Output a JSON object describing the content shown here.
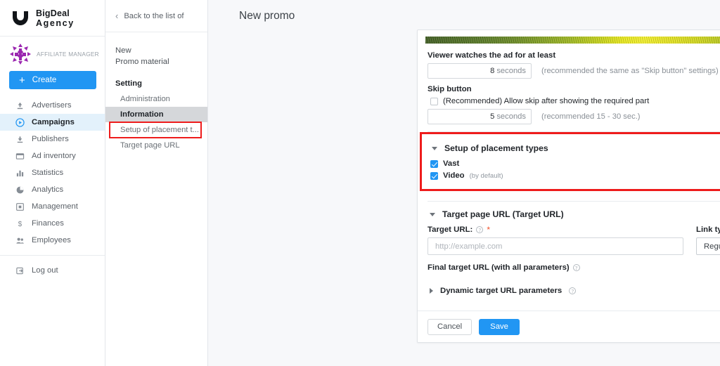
{
  "brand": {
    "line1": "BigDeal",
    "line2": "Agency",
    "logo_icon": "bigdeal-shield-logo"
  },
  "account": {
    "label": "AFFILIATE MANAGER",
    "logo_icon": "affiliate-mandala-logo",
    "create_label": "Create",
    "create_icon": "plus-icon",
    "accent_color": "#2196f3"
  },
  "sidebar": {
    "items": [
      {
        "label": "Advertisers",
        "icon": "upload-arrow-icon",
        "active": false
      },
      {
        "label": "Campaigns",
        "icon": "play-circle-icon",
        "active": true
      },
      {
        "label": "Publishers",
        "icon": "download-arrow-icon",
        "active": false
      },
      {
        "label": "Ad inventory",
        "icon": "browser-window-icon",
        "active": false
      },
      {
        "label": "Statistics",
        "icon": "bar-chart-icon",
        "active": false
      },
      {
        "label": "Analytics",
        "icon": "pie-chart-icon",
        "active": false
      },
      {
        "label": "Management",
        "icon": "grid-square-icon",
        "active": false
      },
      {
        "label": "Finances",
        "icon": "dollar-icon",
        "active": false
      },
      {
        "label": "Employees",
        "icon": "people-icon",
        "active": false
      }
    ],
    "logout": {
      "label": "Log out",
      "icon": "logout-icon"
    }
  },
  "subnav": {
    "back_label": "Back to the list of",
    "back_icon": "chevron-left-icon",
    "title_line1": "New",
    "title_line2": "Promo material",
    "items": [
      {
        "label": "Setting",
        "type": "group",
        "selected": false,
        "boxed": false
      },
      {
        "label": "Administration",
        "type": "indent",
        "selected": false,
        "boxed": false
      },
      {
        "label": "Information",
        "type": "indent",
        "selected": true,
        "boxed": false
      },
      {
        "label": "Setup of placement t...",
        "type": "indent",
        "selected": false,
        "boxed": true
      },
      {
        "label": "Target page URL",
        "type": "indent",
        "selected": false,
        "boxed": false
      }
    ]
  },
  "header": {
    "title": "New promo"
  },
  "form": {
    "watch": {
      "label": "Viewer watches the ad for at least",
      "value": "8",
      "unit": "seconds",
      "hint": "(recommended the same as \"Skip button\" settings)"
    },
    "skip": {
      "label": "Skip button",
      "checkbox_label": "(Recommended) Allow skip after showing the required part",
      "checked": false,
      "value": "5",
      "unit": "seconds",
      "hint": "(recommended 15 - 30 sec.)"
    },
    "placement": {
      "title": "Setup of placement types",
      "expanded": true,
      "highlight_color": "#ee1c1c",
      "options": [
        {
          "label": "Vast",
          "note": "",
          "checked": true
        },
        {
          "label": "Video",
          "note": "(by default)",
          "checked": true
        }
      ]
    },
    "target": {
      "title": "Target page URL (Target URL)",
      "expanded": true,
      "url_label": "Target URL:",
      "url_help_icon": "question-circle-icon",
      "url_required": "*",
      "url_value": "",
      "url_placeholder": "http://example.com",
      "link_type_label": "Link type",
      "link_type_value": "Regular",
      "link_type_options": [
        "Regular"
      ],
      "final_label": "Final target URL (with all parameters)",
      "final_help_icon": "question-circle-icon",
      "dynamic_label": "Dynamic target URL parameters",
      "dynamic_help_icon": "question-circle-icon",
      "dynamic_expanded": false
    },
    "footer": {
      "cancel_label": "Cancel",
      "save_label": "Save"
    }
  }
}
